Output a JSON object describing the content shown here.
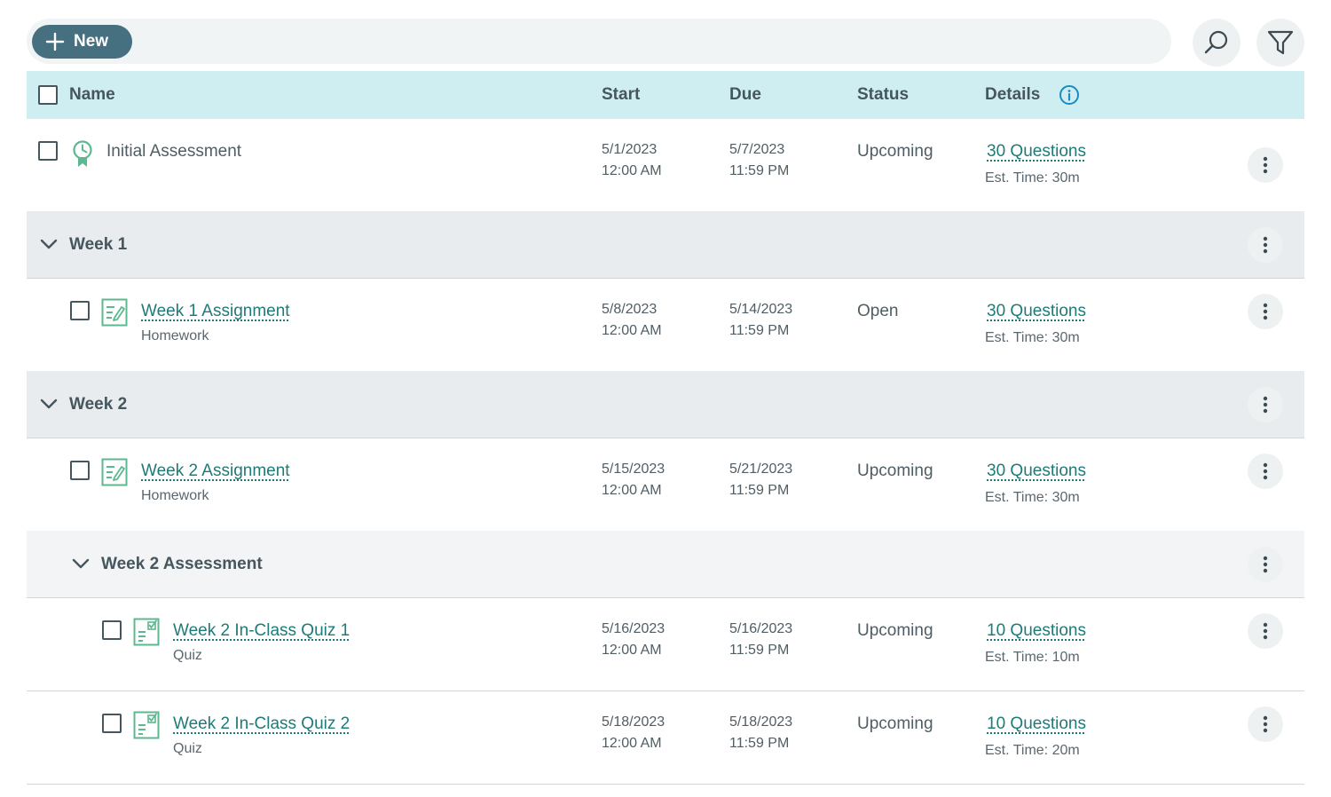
{
  "toolbar": {
    "new_label": "New"
  },
  "header": {
    "name": "Name",
    "start": "Start",
    "due": "Due",
    "status": "Status",
    "details": "Details"
  },
  "rows": {
    "initial": {
      "name": "Initial Assessment",
      "start_date": "5/1/2023",
      "start_time": "12:00 AM",
      "due_date": "5/7/2023",
      "due_time": "11:59 PM",
      "status": "Upcoming",
      "questions": "30 Questions",
      "est": "Est. Time: 30m"
    },
    "week1_group": {
      "title": "Week 1"
    },
    "week1_assignment": {
      "name": "Week 1 Assignment",
      "type": "Homework",
      "start_date": "5/8/2023",
      "start_time": "12:00 AM",
      "due_date": "5/14/2023",
      "due_time": "11:59 PM",
      "status": "Open",
      "questions": "30 Questions",
      "est": "Est. Time: 30m"
    },
    "week2_group": {
      "title": "Week 2"
    },
    "week2_assignment": {
      "name": "Week 2 Assignment",
      "type": "Homework",
      "start_date": "5/15/2023",
      "start_time": "12:00 AM",
      "due_date": "5/21/2023",
      "due_time": "11:59 PM",
      "status": "Upcoming",
      "questions": "30 Questions",
      "est": "Est. Time: 30m"
    },
    "week2_assessment_group": {
      "title": "Week 2 Assessment"
    },
    "quiz1": {
      "name": "Week 2 In-Class Quiz 1",
      "type": "Quiz",
      "start_date": "5/16/2023",
      "start_time": "12:00 AM",
      "due_date": "5/16/2023",
      "due_time": "11:59 PM",
      "status": "Upcoming",
      "questions": "10 Questions",
      "est": "Est. Time: 10m"
    },
    "quiz2": {
      "name": "Week 2 In-Class Quiz 2",
      "type": "Quiz",
      "start_date": "5/18/2023",
      "start_time": "12:00 AM",
      "due_date": "5/18/2023",
      "due_time": "11:59 PM",
      "status": "Upcoming",
      "questions": "10 Questions",
      "est": "Est. Time: 20m"
    }
  },
  "icons": {
    "new": "plus-icon",
    "search": "search-icon",
    "filter": "filter-icon",
    "info": "info-icon",
    "assessment": "assessment-badge-icon",
    "homework": "homework-icon",
    "quiz": "quiz-icon",
    "menu": "more-vertical-icon",
    "expand": "chevron-down-icon"
  },
  "colors": {
    "accent": "#1e7b78",
    "new_button": "#467080",
    "header_bg": "#cfeef2",
    "group_bg": "#e8ecee",
    "icon_green": "#5cb88e"
  }
}
